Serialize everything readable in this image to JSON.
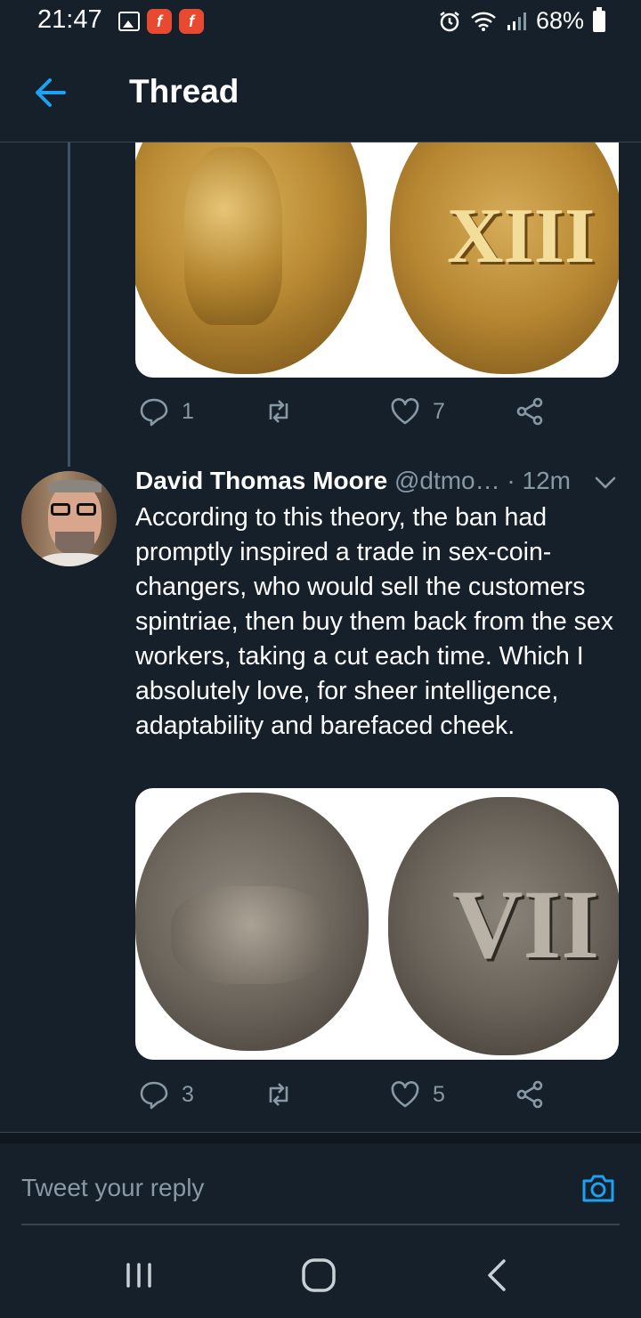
{
  "status_bar": {
    "time": "21:47",
    "battery": "68%"
  },
  "header": {
    "title": "Thread"
  },
  "tweet1": {
    "media": {
      "left_coin": "erotic scene coin",
      "right_coin_numeral": "XIII"
    },
    "actions": {
      "replies": "1",
      "likes": "7"
    }
  },
  "tweet2": {
    "author_name": "David Thomas Moore",
    "handle": "@dtmo…",
    "time": "· 12m",
    "text": "According to this theory, the ban had promptly inspired a trade in sex-coin-changers, who would sell the customers spintriae, then buy them back from the sex workers, taking a cut each time. Which I absolutely love, for sheer intelligence, adaptability and barefaced cheek.",
    "media": {
      "right_coin_numeral": "VII"
    },
    "actions": {
      "replies": "3",
      "likes": "5"
    }
  },
  "reply": {
    "placeholder": "Tweet your reply"
  },
  "colors": {
    "background": "#15202b",
    "accent": "#1da1f2",
    "muted": "#8899a6",
    "border": "#38444d"
  }
}
